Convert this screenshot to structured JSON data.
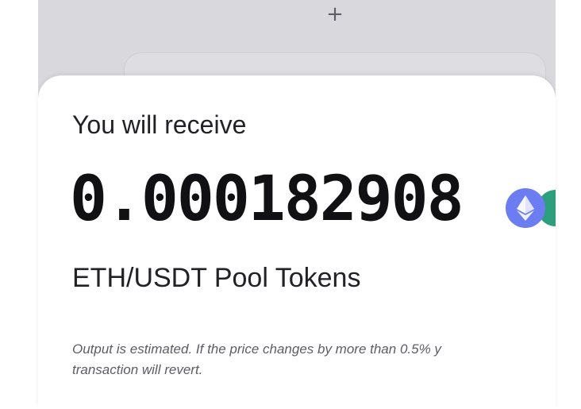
{
  "background": {
    "plus_symbol": "+"
  },
  "sheet": {
    "receive_label": "You will receive",
    "amount": "0.000182908",
    "pool_label": "ETH/USDT Pool Tokens",
    "note_line1": "Output is estimated. If the price changes by more than 0.5% y",
    "note_line2": "transaction will revert.",
    "token_icons": [
      "eth-icon",
      "usdt-icon"
    ]
  },
  "colors": {
    "eth": "#6b7df0",
    "usdt": "#2e9e7c",
    "backdrop": "#d9d8dc"
  }
}
